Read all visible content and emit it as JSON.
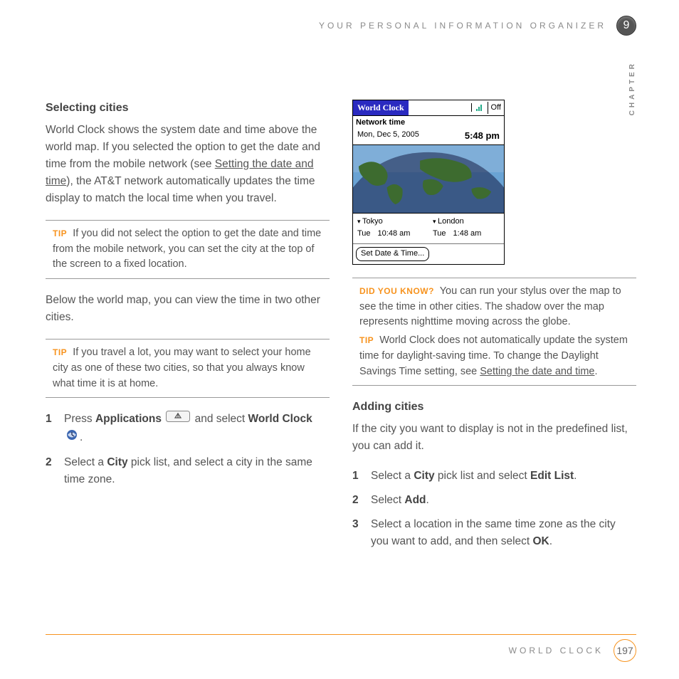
{
  "header": {
    "section_title": "YOUR PERSONAL INFORMATION ORGANIZER",
    "chapter_num": "9",
    "chapter_label": "CHAPTER"
  },
  "left": {
    "h_selecting": "Selecting cities",
    "p1a": "World Clock shows the system date and time above the world map. If you selected the option to get the date and time from the mobile network (see ",
    "p1_link": "Setting the date and time",
    "p1b": "), the AT&T network automatically updates the time display to match the local time when you travel.",
    "tip1_label": "TIP",
    "tip1": " If you did not select the option to get the date and time from the mobile network, you can set the city at the top of the screen to a fixed location.",
    "p2": "Below the world map, you can view the time in two other cities.",
    "tip2_label": "TIP",
    "tip2": " If you travel a lot, you may want to select your home city as one of these two cities, so that you always know what time it is at home.",
    "step1a": "Press ",
    "step1_b1": "Applications",
    "step1b": " and select ",
    "step1_b2": "World Clock",
    "step1c": ".",
    "step2a": "Select a ",
    "step2_b1": "City",
    "step2b": " pick list, and select a city in the same time zone."
  },
  "right": {
    "dyk_label": "DID YOU KNOW?",
    "dyk": " You can run your stylus over the map to see the time in other cities. The shadow over the map represents nighttime moving across the globe.",
    "tip3_label": "TIP",
    "tip3a": " World Clock does not automatically update the system time for daylight-saving time. To change the Daylight Savings Time setting, see ",
    "tip3_link": "Setting the date and time",
    "tip3b": ".",
    "h_adding": "Adding cities",
    "p3": "If the city you want to display is not in the predefined list, you can add it.",
    "r_step1a": "Select a ",
    "r_step1_b1": "City",
    "r_step1b": " pick list and select ",
    "r_step1_b2": "Edit List",
    "r_step1c": ".",
    "r_step2a": "Select ",
    "r_step2_b1": "Add",
    "r_step2b": ".",
    "r_step3a": "Select a location in the same time zone as the city you want to add, and then select ",
    "r_step3_b1": "OK",
    "r_step3b": "."
  },
  "screenshot": {
    "title": "World Clock",
    "off": "Off",
    "subhead": "Network time",
    "date": "Mon, Dec 5, 2005",
    "time": "5:48 pm",
    "city1": {
      "name": "Tokyo",
      "day": "Tue",
      "time": "10:48 am"
    },
    "city2": {
      "name": "London",
      "day": "Tue",
      "time": "1:48 am"
    },
    "setdate": "Set Date & Time..."
  },
  "footer": {
    "section": "WORLD CLOCK",
    "page": "197"
  }
}
